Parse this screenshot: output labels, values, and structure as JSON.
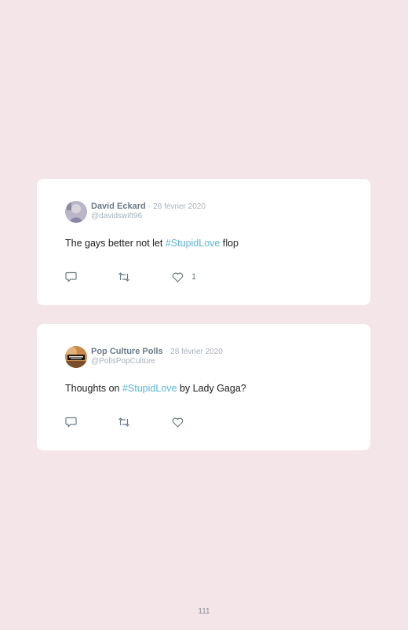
{
  "tweets": [
    {
      "author_name": "David Eckard",
      "separator": "·",
      "date": "28 février 2020",
      "handle": "@davidswift96",
      "text_before": "The gays better not let ",
      "hashtag": "#StupidLove",
      "text_after": " flop",
      "like_count": "1",
      "icons": [
        "reply-icon",
        "retweet-icon",
        "heart-icon"
      ],
      "colors": {
        "name": "#6b7a89",
        "hashtag": "#5bb5d9",
        "meta": "#a6b2bc"
      }
    },
    {
      "author_name": "Pop Culture Polls",
      "separator": "·",
      "date": "28 février 2020",
      "handle": "@PollsPopCulture",
      "text_before": "Thoughts on ",
      "hashtag": "#StupidLove",
      "text_after": " by Lady Gaga?",
      "like_count": "",
      "icons": [
        "reply-icon",
        "retweet-icon",
        "heart-icon"
      ],
      "colors": {
        "name": "#6b7a89",
        "hashtag": "#5bb5d9",
        "meta": "#a6b2bc"
      }
    }
  ],
  "page_number": "111",
  "background_color": "#f3e5e8"
}
